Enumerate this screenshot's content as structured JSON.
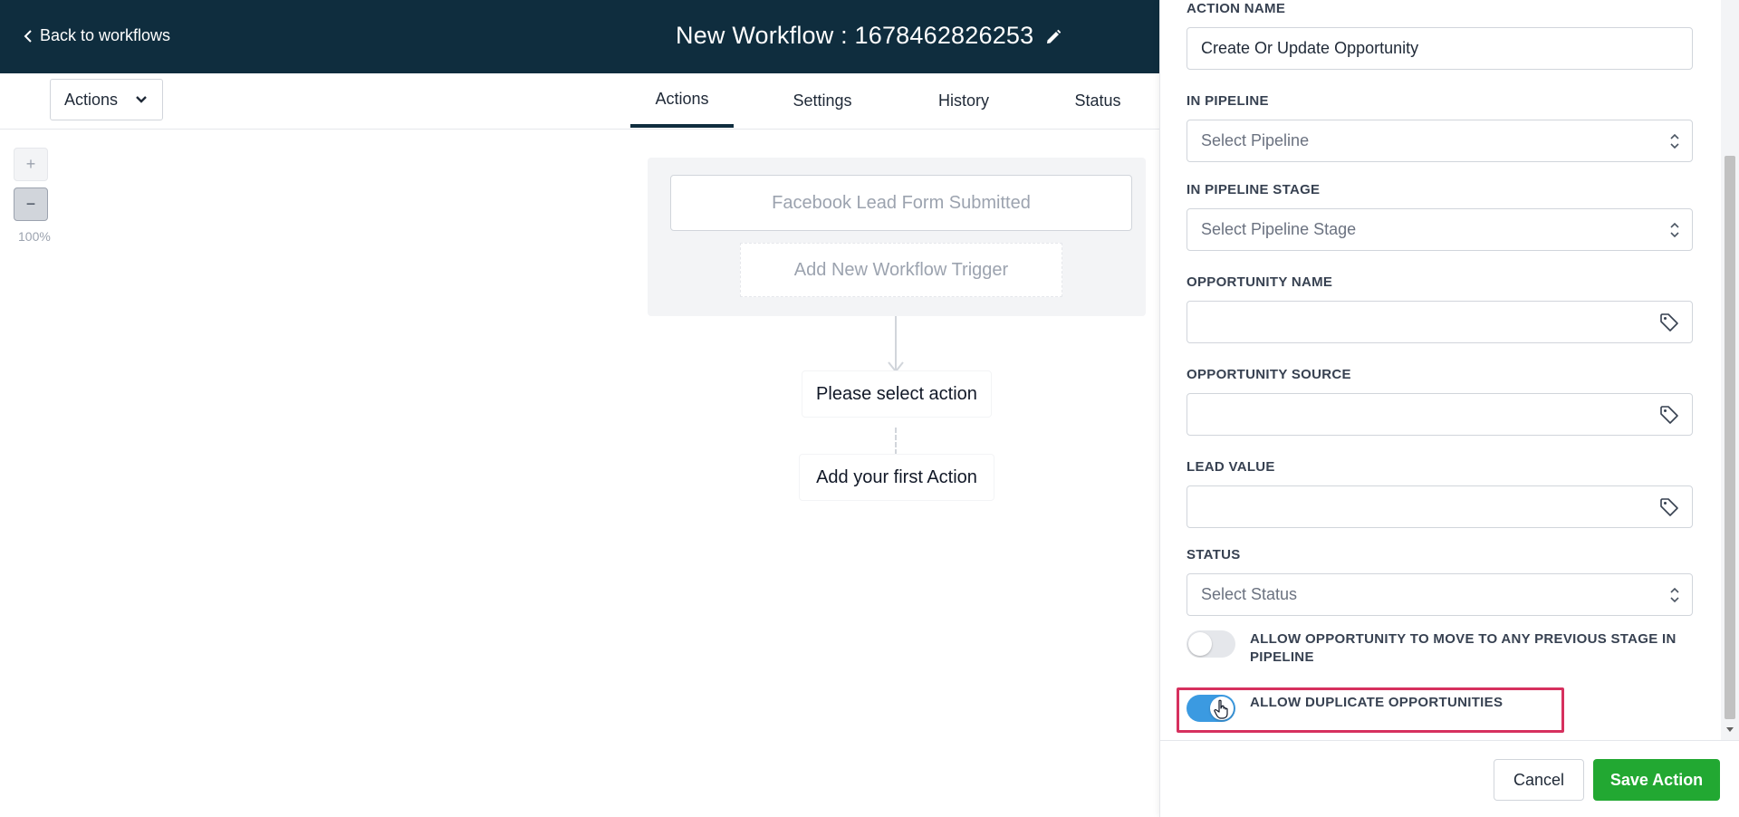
{
  "header": {
    "back_label": "Back to workflows",
    "title": "New Workflow : 1678462826253"
  },
  "toolbar": {
    "actions_dropdown": "Actions"
  },
  "tabs": [
    {
      "label": "Actions",
      "active": true
    },
    {
      "label": "Settings",
      "active": false
    },
    {
      "label": "History",
      "active": false
    },
    {
      "label": "Status",
      "active": false
    }
  ],
  "zoom": {
    "in_label": "+",
    "out_label": "−",
    "level": "100%"
  },
  "canvas": {
    "trigger": "Facebook Lead Form Submitted",
    "add_trigger": "Add New Workflow Trigger",
    "select_action": "Please select action",
    "first_action": "Add your first Action"
  },
  "panel": {
    "action_name": {
      "label": "ACTION NAME",
      "value": "Create Or Update Opportunity"
    },
    "pipeline": {
      "label": "IN PIPELINE",
      "placeholder": "Select Pipeline"
    },
    "pipeline_stage": {
      "label": "IN PIPELINE STAGE",
      "placeholder": "Select Pipeline Stage"
    },
    "opportunity_name": {
      "label": "OPPORTUNITY NAME",
      "value": ""
    },
    "opportunity_source": {
      "label": "OPPORTUNITY SOURCE",
      "value": ""
    },
    "lead_value": {
      "label": "LEAD VALUE",
      "value": ""
    },
    "status": {
      "label": "STATUS",
      "placeholder": "Select Status"
    },
    "toggle_previous_stage": {
      "label": "ALLOW OPPORTUNITY TO MOVE TO ANY PREVIOUS STAGE IN PIPELINE",
      "on": false
    },
    "toggle_duplicates": {
      "label": "ALLOW DUPLICATE OPPORTUNITIES",
      "on": true
    },
    "cancel_label": "Cancel",
    "save_label": "Save Action"
  },
  "colors": {
    "header_bg": "#0f2d3e",
    "save_button": "#22a832",
    "toggle_on": "#3b9ae1",
    "highlight": "#d6305e"
  }
}
